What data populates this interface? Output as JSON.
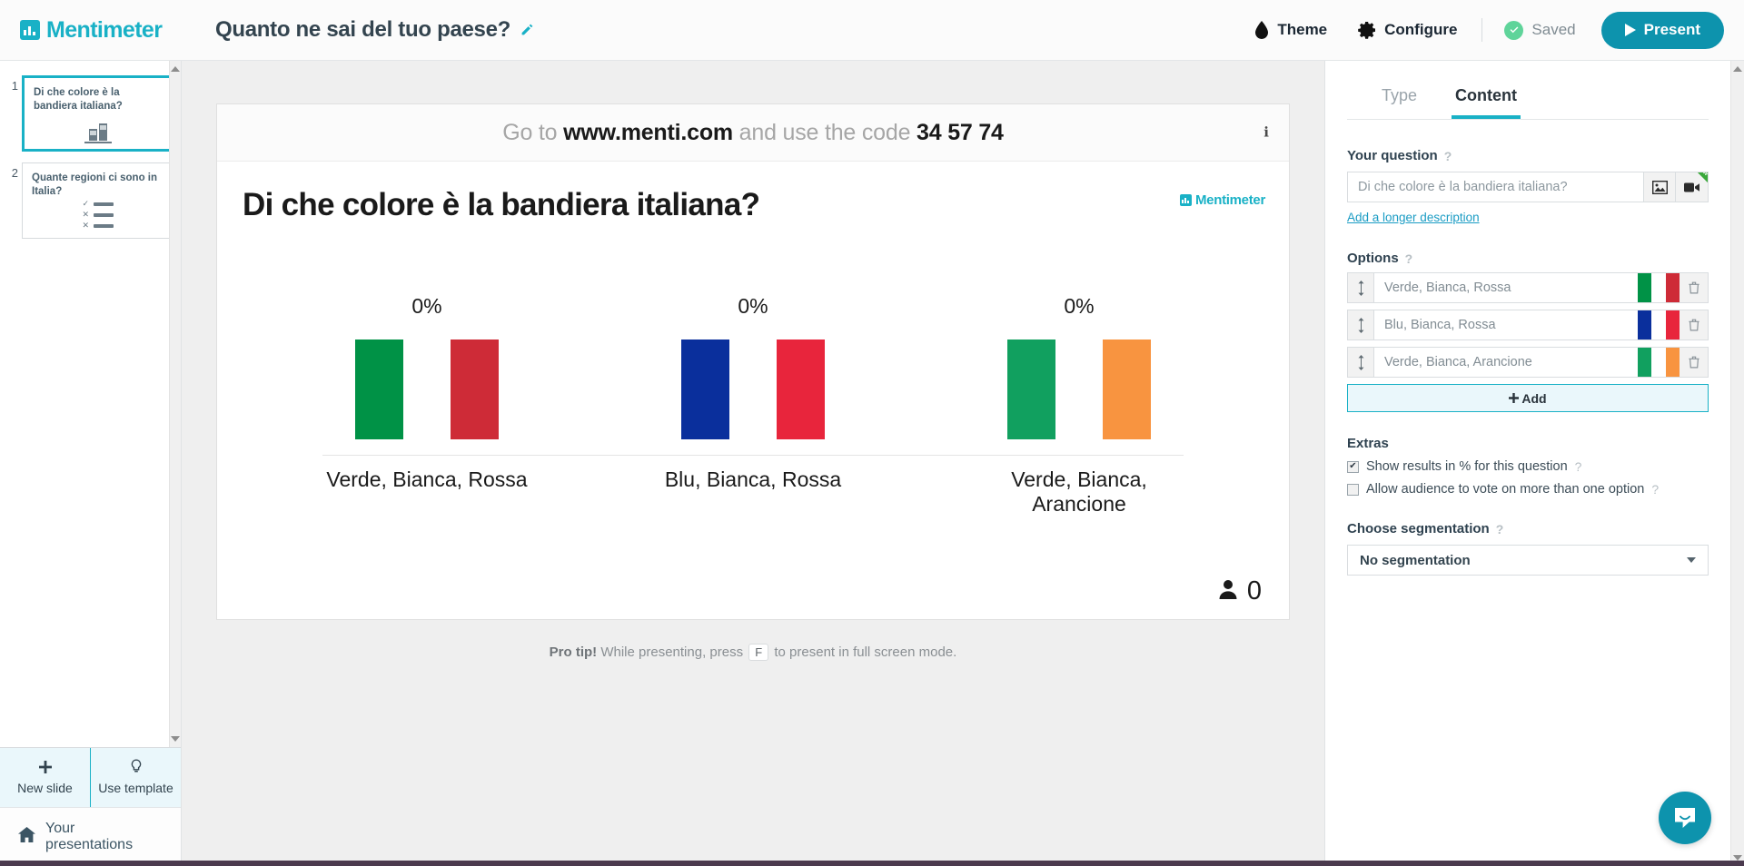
{
  "topbar": {
    "brand": "Mentimeter",
    "deck_title": "Quanto ne sai del tuo paese?",
    "edit_icon": "pencil-icon",
    "theme_label": "Theme",
    "configure_label": "Configure",
    "saved_label": "Saved",
    "present_label": "Present",
    "accent": "#19b1c6",
    "present_bg": "#0d93ad"
  },
  "slides": {
    "items": [
      {
        "number": "1",
        "text": "Di che colore è la bandiera italiana?",
        "icon": "bar-chart-icon",
        "active": true
      },
      {
        "number": "2",
        "text": "Quante regioni ci sono in Italia?",
        "icon": "quiz-list-icon",
        "active": false
      }
    ],
    "new_slide_label": "New slide",
    "use_template_label": "Use template",
    "your_presentations_label": "Your presentations"
  },
  "preview": {
    "instructions_prefix": "Go to ",
    "instructions_site": "www.menti.com",
    "instructions_middle": " and use the code ",
    "instructions_code": "34 57 74",
    "info_icon": "info-icon",
    "question_title": "Di che colore è la bandiera italiana?",
    "watermark": "Mentimeter",
    "voter_count": "0",
    "pro_tip_bold": "Pro tip!",
    "pro_tip_before": " While presenting, press ",
    "pro_tip_key": "F",
    "pro_tip_after": " to present in full screen mode."
  },
  "chart_data": {
    "type": "bar",
    "title": "Di che colore è la bandiera italiana?",
    "categories": [
      "Verde, Bianca, Rossa",
      "Blu, Bianca, Rossa",
      "Verde, Bianca, Arancione"
    ],
    "values": [
      0,
      0,
      0
    ],
    "value_labels": [
      "0%",
      "0%",
      "0%"
    ],
    "unit": "%",
    "xlabel": "",
    "ylabel": "",
    "ylim": [
      0,
      100
    ],
    "grid": false,
    "legend": "none",
    "bar_style": "flag-tricolor",
    "bar_colors": [
      [
        "#009246",
        "#FFFFFF",
        "#CE2B37"
      ],
      [
        "#0a2f9c",
        "#FFFFFF",
        "#E8253C"
      ],
      [
        "#11a05f",
        "#FFFFFF",
        "#F89440"
      ]
    ]
  },
  "panel": {
    "tabs": [
      {
        "label": "Type",
        "active": false
      },
      {
        "label": "Content",
        "active": true
      }
    ],
    "question_section_label": "Your question",
    "question_value": "Di che colore è la bandiera italiana?",
    "question_placeholder": "Di che colore è la bandiera italiana?",
    "image_button_icon": "image-icon",
    "video_button_icon": "video-camera-icon",
    "video_badge": "NEW",
    "add_description_link": "Add a longer description",
    "options_section_label": "Options",
    "options": [
      {
        "value": "Verde, Bianca, Rossa",
        "colors": [
          "#009246",
          "#FFFFFF",
          "#CE2B37"
        ]
      },
      {
        "value": "Blu, Bianca, Rossa",
        "colors": [
          "#0a2f9c",
          "#FFFFFF",
          "#E8253C"
        ]
      },
      {
        "value": "Verde, Bianca, Arancione",
        "colors": [
          "#11a05f",
          "#FFFFFF",
          "#F89440"
        ]
      }
    ],
    "add_label": "Add",
    "extras_label": "Extras",
    "extras": [
      {
        "label": "Show results in % for this question",
        "checked": true
      },
      {
        "label": "Allow audience to vote on more than one option",
        "checked": false
      }
    ],
    "segmentation_label": "Choose segmentation",
    "segmentation_value": "No segmentation",
    "help_glyph": "?"
  },
  "support": {
    "chat_icon": "chat-bubble-icon"
  }
}
